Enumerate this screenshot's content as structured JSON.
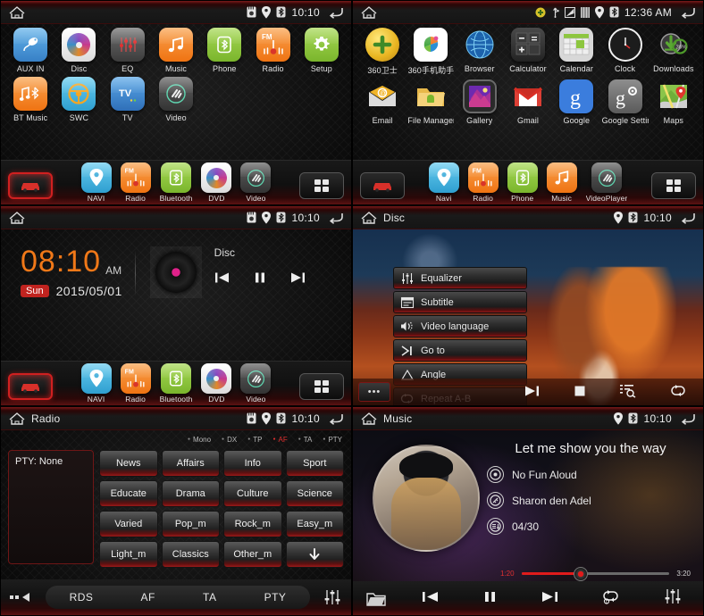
{
  "panels": {
    "home_page1": {
      "statusbar": {
        "title": "",
        "time": "10:10",
        "icons": [
          "sd-card-icon",
          "location-icon",
          "bluetooth-icon"
        ],
        "back_icon": "back-arrow-icon",
        "home_icon": "home-icon"
      },
      "apps_row1": [
        {
          "label": "AUX IN",
          "icon": "aux-plug-icon",
          "color": "#4a9fe0"
        },
        {
          "label": "Disc",
          "icon": "disc-icon",
          "color": "#f2f2f2"
        },
        {
          "label": "EQ",
          "icon": "equalizer-icon",
          "color": "#5a5a5a"
        },
        {
          "label": "Music",
          "icon": "music-note-icon",
          "color": "#f5862a"
        },
        {
          "label": "Phone",
          "icon": "bluetooth-phone-icon",
          "color": "#8dc63f"
        },
        {
          "label": "Radio",
          "icon": "fm-radio-icon",
          "color": "#f5862a"
        },
        {
          "label": "Setup",
          "icon": "gear-icon",
          "color": "#8dc63f"
        }
      ],
      "apps_row2": [
        {
          "label": "BT Music",
          "icon": "bt-music-icon",
          "color": "#f5862a"
        },
        {
          "label": "SWC",
          "icon": "steering-wheel-icon",
          "color": "#4ab8e0"
        },
        {
          "label": "TV",
          "icon": "tv-icon",
          "color": "#4a90d9"
        },
        {
          "label": "Video",
          "icon": "video-icon",
          "color": "#4a4a4a"
        }
      ],
      "dock": [
        {
          "label": "NAVI",
          "icon": "map-pin-icon",
          "color": "#4ab8e0"
        },
        {
          "label": "Radio",
          "icon": "fm-radio-icon",
          "color": "#f5862a"
        },
        {
          "label": "Bluetooth",
          "icon": "bluetooth-icon",
          "color": "#8dc63f"
        },
        {
          "label": "DVD",
          "icon": "disc-icon",
          "color": "#f2f2f2"
        },
        {
          "label": "Video",
          "icon": "video-icon",
          "color": "#4a4a4a"
        }
      ],
      "corner_left_icon": "car-icon",
      "corner_right_icon": "apps-grid-icon"
    },
    "home_page2": {
      "statusbar": {
        "title": "",
        "time": "12:36 AM",
        "icons": [
          "update-icon",
          "usb-icon",
          "screenshot-icon",
          "sim-icon",
          "location-icon",
          "bluetooth-icon"
        ],
        "back_icon": "back-arrow-icon",
        "home_icon": "home-icon"
      },
      "apps_row1": [
        {
          "label": "360卫士",
          "icon": "360-guard-icon",
          "color": "#f0c030"
        },
        {
          "label": "360手机助手",
          "icon": "360-assistant-icon",
          "color": "#ffffff"
        },
        {
          "label": "Browser",
          "icon": "globe-icon",
          "color": "#1a5fa8"
        },
        {
          "label": "Calculator",
          "icon": "calculator-icon",
          "color": "#3a3a3a"
        },
        {
          "label": "Calendar",
          "icon": "calendar-icon",
          "color": "#cfcfcf"
        },
        {
          "label": "Clock",
          "icon": "clock-icon",
          "color": "#1a1a1a"
        },
        {
          "label": "Downloads",
          "icon": "download-icon",
          "color": "#2f2f2f"
        }
      ],
      "downloads_badge": "36%",
      "apps_row2": [
        {
          "label": "Email",
          "icon": "email-icon",
          "color": "#f0b429"
        },
        {
          "label": "File Manager",
          "icon": "folder-icon",
          "color": "#f2c14e"
        },
        {
          "label": "Gallery",
          "icon": "gallery-icon",
          "color": "#2a2a2a"
        },
        {
          "label": "Gmail",
          "icon": "gmail-icon",
          "color": "#ffffff"
        },
        {
          "label": "Google",
          "icon": "google-g-icon",
          "color": "#3b7ddd"
        },
        {
          "label": "Google Settings",
          "icon": "google-settings-icon",
          "color": "#7a7a7a"
        },
        {
          "label": "Maps",
          "icon": "maps-icon",
          "color": "#8ac44a"
        }
      ],
      "dock": [
        {
          "label": "Navi",
          "icon": "map-pin-icon",
          "color": "#4ab8e0"
        },
        {
          "label": "Radio",
          "icon": "fm-radio-icon",
          "color": "#f5862a"
        },
        {
          "label": "Phone",
          "icon": "bluetooth-phone-icon",
          "color": "#8dc63f"
        },
        {
          "label": "Music",
          "icon": "music-note-icon",
          "color": "#f5862a"
        },
        {
          "label": "VideoPlayer",
          "icon": "video-icon",
          "color": "#4a4a4a"
        }
      ],
      "corner_left_icon": "car-icon",
      "corner_right_icon": "apps-grid-icon"
    },
    "clock_home": {
      "statusbar": {
        "title": "",
        "time": "10:10",
        "icons": [
          "sd-card-icon",
          "location-icon",
          "bluetooth-icon"
        ],
        "back_icon": "back-arrow-icon",
        "home_icon": "home-icon"
      },
      "clock": {
        "time": "08:10",
        "ampm": "AM",
        "weekday": "Sun",
        "date": "2015/05/01"
      },
      "now_playing": {
        "source": "Disc",
        "prev_icon": "previous-track-icon",
        "pause_icon": "pause-icon",
        "next_icon": "next-track-icon"
      },
      "dock": [
        {
          "label": "NAVI",
          "icon": "map-pin-icon",
          "color": "#4ab8e0"
        },
        {
          "label": "Radio",
          "icon": "fm-radio-icon",
          "color": "#f5862a"
        },
        {
          "label": "Bluetooth",
          "icon": "bluetooth-icon",
          "color": "#8dc63f"
        },
        {
          "label": "DVD",
          "icon": "disc-icon",
          "color": "#f2f2f2"
        },
        {
          "label": "Video",
          "icon": "video-icon",
          "color": "#4a4a4a"
        }
      ],
      "corner_left_icon": "car-icon",
      "corner_right_icon": "apps-grid-icon"
    },
    "disc_player": {
      "statusbar": {
        "title": "Disc",
        "time": "10:10",
        "icons": [
          "location-icon",
          "bluetooth-icon"
        ],
        "back_icon": "back-arrow-icon",
        "home_icon": "home-icon"
      },
      "menu": [
        {
          "label": "Equalizer",
          "icon": "equalizer-icon"
        },
        {
          "label": "Subtitle",
          "icon": "subtitle-icon"
        },
        {
          "label": "Video language",
          "icon": "audio-language-icon"
        },
        {
          "label": "Go to",
          "icon": "goto-icon"
        },
        {
          "label": "Angle",
          "icon": "angle-icon"
        },
        {
          "label": "Repeat A-B",
          "icon": "repeat-ab-icon"
        }
      ],
      "controls": {
        "more_label": "•••",
        "items": [
          "next-track-icon",
          "stop-icon",
          "playlist-icon",
          "repeat-icon"
        ]
      }
    },
    "radio": {
      "statusbar": {
        "title": "Radio",
        "time": "10:10",
        "icons": [
          "sd-card-icon",
          "location-icon",
          "bluetooth-icon"
        ],
        "back_icon": "back-arrow-icon",
        "home_icon": "home-icon"
      },
      "indicators": [
        {
          "label": "Mono",
          "active": false
        },
        {
          "label": "DX",
          "active": false
        },
        {
          "label": "TP",
          "active": false
        },
        {
          "label": "AF",
          "active": true
        },
        {
          "label": "TA",
          "active": false
        },
        {
          "label": "PTY",
          "active": false
        }
      ],
      "pty_status": "PTY:  None",
      "pty_buttons": [
        "News",
        "Affairs",
        "Info",
        "Sport",
        "Educate",
        "Drama",
        "Culture",
        "Science",
        "Varied",
        "Pop_m",
        "Rock_m",
        "Easy_m",
        "Light_m",
        "Classics",
        "Other_m",
        "⬇"
      ],
      "tabs": [
        "RDS",
        "AF",
        "TA",
        "PTY"
      ],
      "tab_left_icon": "more-back-icon",
      "tab_right_icon": "equalizer-icon",
      "active_color": "#e03030"
    },
    "music": {
      "statusbar": {
        "title": "Music",
        "time": "10:10",
        "icons": [
          "location-icon",
          "bluetooth-icon"
        ],
        "back_icon": "back-arrow-icon",
        "home_icon": "home-icon"
      },
      "track": {
        "title": "Let me show you the way",
        "album": "No Fun Aloud",
        "artist": "Sharon den Adel",
        "track_number": "04/30",
        "album_icon": "album-icon",
        "artist_icon": "artist-icon",
        "list_icon": "track-list-icon"
      },
      "progress": {
        "current_time": "1:20",
        "total_time": "3:20",
        "percent": 40
      },
      "controls": {
        "folder_icon": "folder-icon",
        "items": [
          "previous-track-icon",
          "pause-icon",
          "next-track-icon",
          "repeat-one-icon",
          "equalizer-icon"
        ]
      }
    }
  }
}
